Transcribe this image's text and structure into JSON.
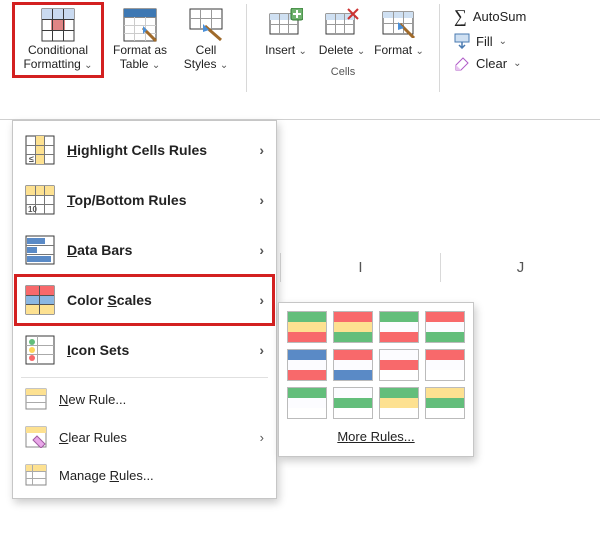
{
  "ribbon": {
    "conditional_formatting": "Conditional Formatting",
    "format_as_table": "Format as Table",
    "cell_styles": "Cell Styles",
    "insert": "Insert",
    "delete": "Delete",
    "format": "Format",
    "cells_group": "Cells",
    "autosum": "AutoSum",
    "fill": "Fill",
    "clear": "Clear"
  },
  "menu": {
    "highlight": "Highlight Cells Rules",
    "topbottom": "Top/Bottom Rules",
    "databars": "Data Bars",
    "colorscales": "Color Scales",
    "iconsets": "Icon Sets",
    "newrule": "New Rule...",
    "clearrules": "Clear Rules",
    "managerules": "Manage Rules..."
  },
  "submenu": {
    "more_rules": "More Rules..."
  },
  "sheet": {
    "col_i": "I",
    "col_j": "J"
  },
  "colorscale_presets": [
    [
      "#63be7b",
      "#fde191",
      "#f8696b"
    ],
    [
      "#f8696b",
      "#fde191",
      "#63be7b"
    ],
    [
      "#63be7b",
      "#fcfcff",
      "#f8696b"
    ],
    [
      "#f8696b",
      "#fcfcff",
      "#63be7b"
    ],
    [
      "#5a8ac6",
      "#fcfcff",
      "#f8696b"
    ],
    [
      "#f8696b",
      "#fcfcff",
      "#5a8ac6"
    ],
    [
      "#fcfcff",
      "#f8696b",
      "#ffffff"
    ],
    [
      "#f8696b",
      "#fcfcff",
      "#ffffff"
    ],
    [
      "#63be7b",
      "#fcfcff",
      "#ffffff"
    ],
    [
      "#fcfcff",
      "#63be7b",
      "#ffffff"
    ],
    [
      "#63be7b",
      "#fde191",
      "#ffffff"
    ],
    [
      "#fde191",
      "#63be7b",
      "#ffffff"
    ]
  ]
}
